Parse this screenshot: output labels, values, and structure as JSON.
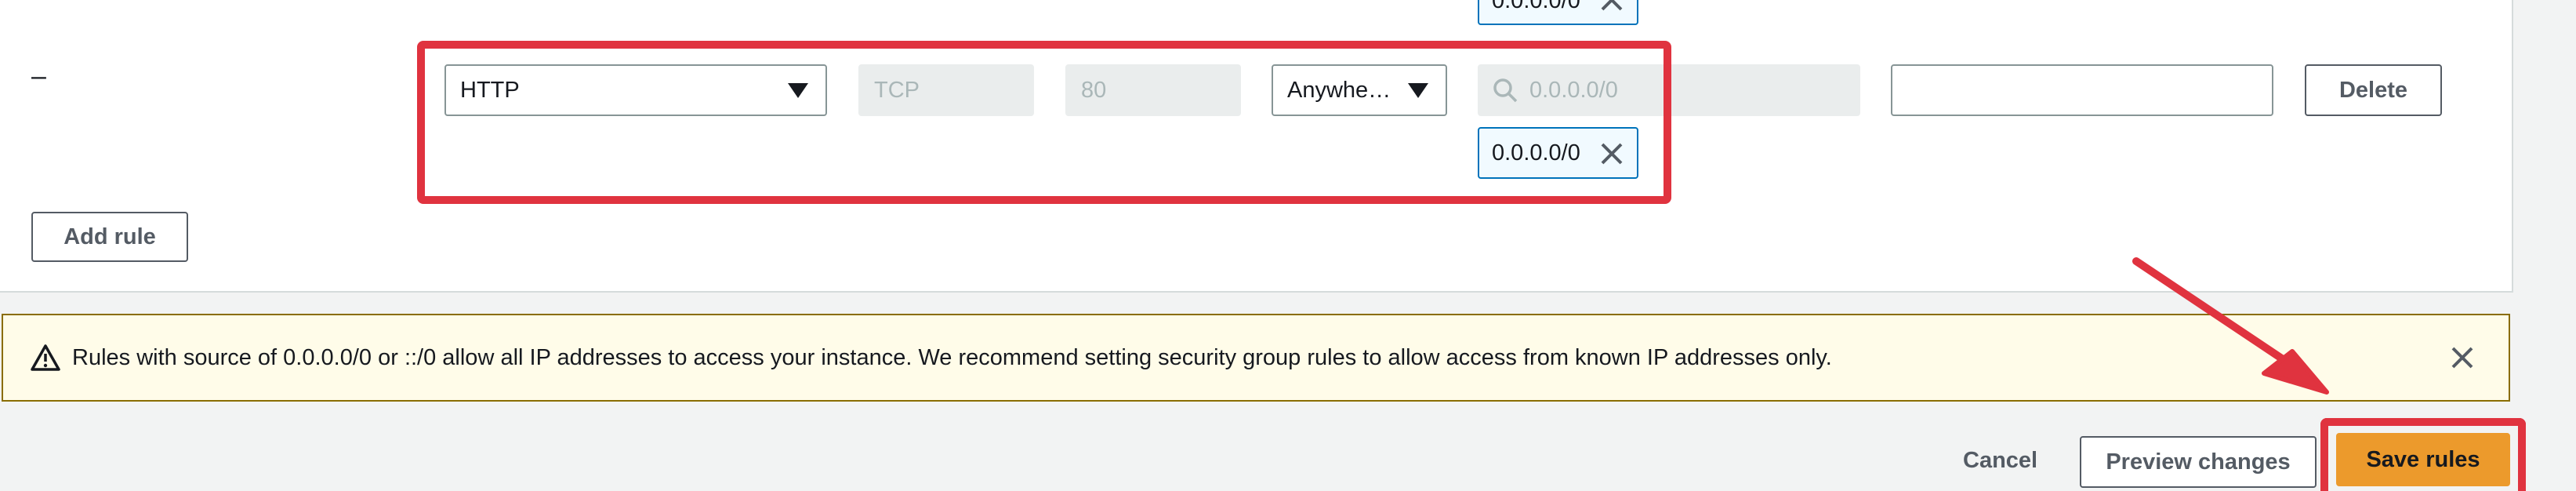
{
  "rule": {
    "dash": "–",
    "type": "HTTP",
    "protocol": "TCP",
    "port_range": "80",
    "source_type": "Anywhe…",
    "source_search_placeholder": "0.0.0.0/0",
    "source_token": "0.0.0.0/0",
    "source_token_above": "0.0.0.0/0",
    "description_value": "",
    "delete_label": "Delete"
  },
  "add_rule_label": "Add rule",
  "alert": {
    "message": "Rules with source of 0.0.0.0/0 or ::/0 allow all IP addresses to access your instance. We recommend setting security group rules to allow access from known IP addresses only."
  },
  "footer": {
    "cancel_label": "Cancel",
    "preview_label": "Preview changes",
    "save_label": "Save rules"
  },
  "colors": {
    "annotation_red": "#e0333f",
    "primary_orange": "#ec9a2c",
    "alert_background": "#fffce9",
    "token_blue": "#0073bb"
  },
  "icons": [
    "search-icon",
    "close-icon",
    "warning-icon",
    "caret-down-icon",
    "arrow-annotation-icon"
  ]
}
